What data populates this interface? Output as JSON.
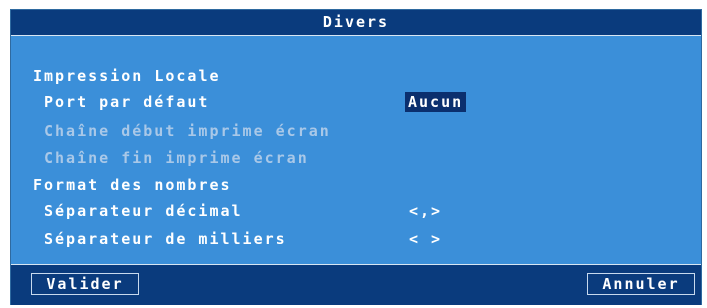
{
  "dialog": {
    "title": "Divers",
    "section_local_print": "Impression Locale",
    "default_port_label": "Port par défaut",
    "default_port_value": "Aucun",
    "print_screen_start_label": "Chaîne début imprime écran",
    "print_screen_end_label": "Chaîne fin imprime écran",
    "section_number_format": "Format des nombres",
    "decimal_separator_label": "Séparateur décimal",
    "decimal_separator_value": "<,>",
    "thousands_separator_label": "Séparateur de milliers",
    "thousands_separator_value": "< >"
  },
  "buttons": {
    "validate": "Valider",
    "cancel": "Annuler"
  },
  "colors": {
    "panel": "#3b8fd9",
    "titlebar": "#0a3b7d",
    "selected": "#0b2f6e",
    "dim_text": "#a9c8e8"
  }
}
